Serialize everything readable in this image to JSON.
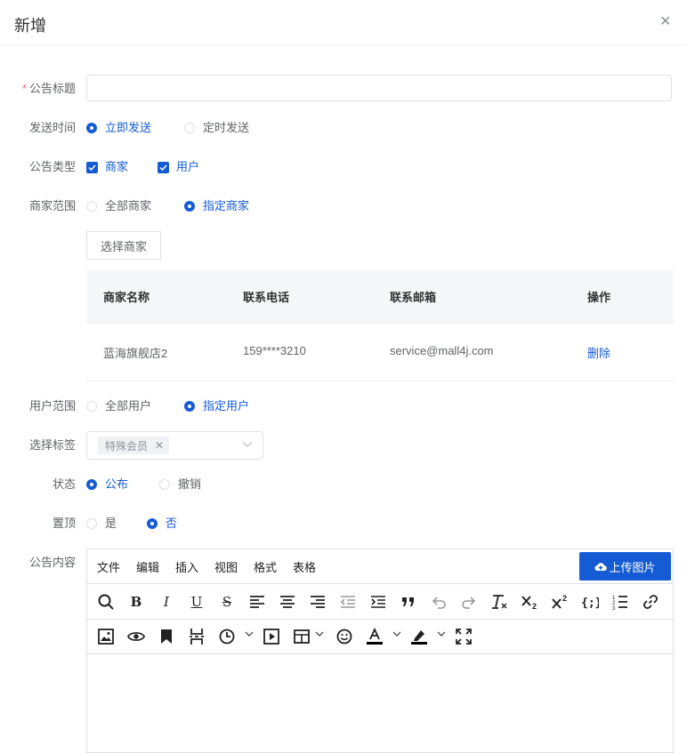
{
  "dialog": {
    "title": "新增",
    "close_icon": "close-icon"
  },
  "form": {
    "title": {
      "label": "公告标题",
      "required_mark": "*",
      "value": "",
      "placeholder": ""
    },
    "send_time": {
      "label": "发送时间",
      "options": [
        "立即发送",
        "定时发送"
      ],
      "selected": "立即发送"
    },
    "notice_type": {
      "label": "公告类型",
      "options": [
        "商家",
        "用户"
      ],
      "checked": [
        "商家",
        "用户"
      ]
    },
    "merchant_scope": {
      "label": "商家范围",
      "options": [
        "全部商家",
        "指定商家"
      ],
      "selected": "指定商家"
    },
    "select_merchant_button": "选择商家",
    "merchant_table": {
      "columns": [
        "商家名称",
        "联系电话",
        "联系邮箱",
        "操作"
      ],
      "rows": [
        {
          "name": "蓝海旗舰店2",
          "phone": "159****3210",
          "email": "service@mall4j.com",
          "action": "删除"
        }
      ]
    },
    "user_scope": {
      "label": "用户范围",
      "options": [
        "全部用户",
        "指定用户"
      ],
      "selected": "指定用户"
    },
    "select_tag": {
      "label": "选择标签",
      "tags": [
        "特殊会员"
      ]
    },
    "status": {
      "label": "状态",
      "options": [
        "公布",
        "撤销"
      ],
      "selected": "公布"
    },
    "pin_top": {
      "label": "置顶",
      "options": [
        "是",
        "否"
      ],
      "selected": "否"
    },
    "content": {
      "label": "公告内容"
    }
  },
  "editor": {
    "menus": [
      "文件",
      "编辑",
      "插入",
      "视图",
      "格式",
      "表格"
    ],
    "upload_button": "上传图片",
    "toolbar_row1": [
      "search-icon",
      "bold-icon",
      "italic-icon",
      "underline-icon",
      "strikethrough-icon",
      "align-left-icon",
      "align-center-icon",
      "align-right-icon",
      "outdent-icon",
      "indent-icon",
      "blockquote-icon",
      "undo-icon",
      "redo-icon",
      "clear-format-icon",
      "subscript-icon",
      "superscript-icon",
      "code-icon",
      "numbered-list-icon",
      "link-icon"
    ],
    "toolbar_row2": [
      "image-icon",
      "preview-icon",
      "bookmark-icon",
      "page-break-icon",
      "clock-icon",
      "media-icon",
      "table-icon",
      "emoji-icon",
      "text-color-icon",
      "highlight-color-icon",
      "fullscreen-icon"
    ]
  },
  "colors": {
    "primary": "#155bd4",
    "required": "#f56c6c",
    "border": "#dcdfe6",
    "table_header_bg": "#f6f7f9"
  }
}
